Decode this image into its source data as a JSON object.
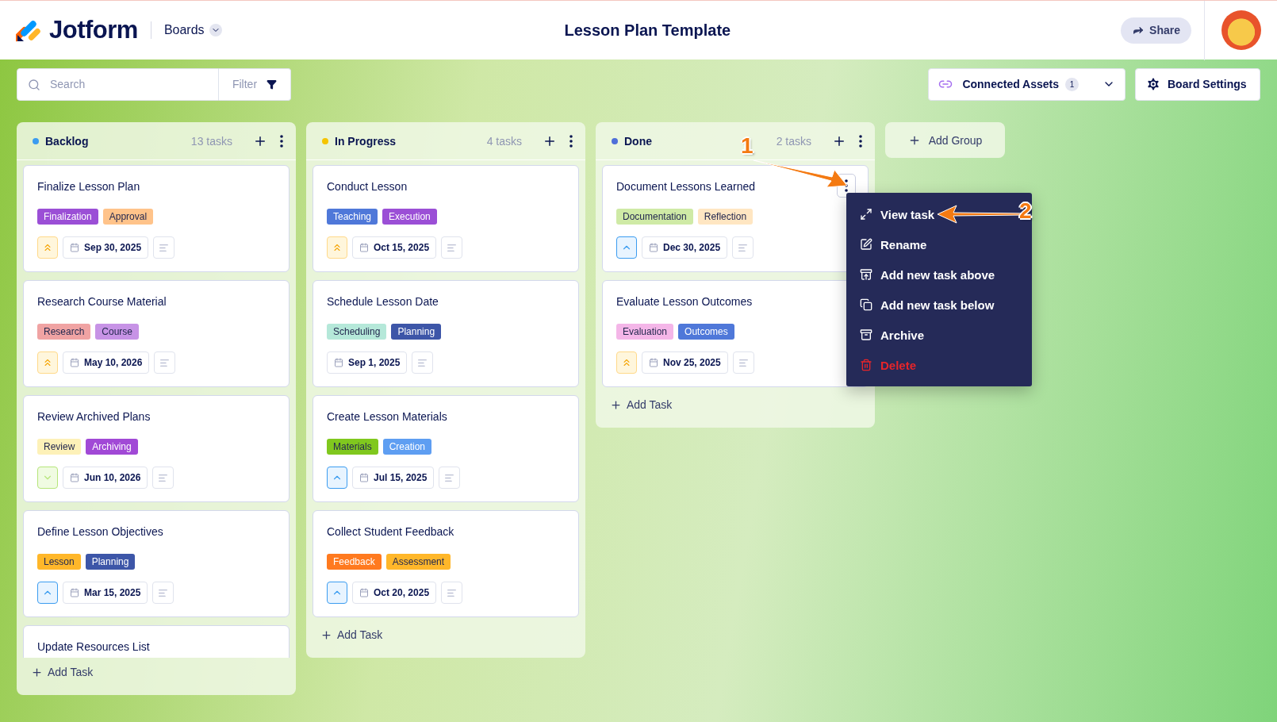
{
  "header": {
    "logo": "Jotform",
    "boards_menu": "Boards",
    "title": "Lesson Plan Template",
    "share_button": "Share"
  },
  "toolbar": {
    "search": {
      "placeholder": "Search"
    },
    "filter_button": "Filter",
    "connected_assets": {
      "label": "Connected Assets",
      "count": "1"
    },
    "board_settings": "Board Settings"
  },
  "groups": [
    {
      "name": "Backlog",
      "color": "#3b9cf0",
      "count": "13 tasks",
      "add_task": "Add Task",
      "cards": [
        {
          "title": "Finalize Lesson Plan",
          "hovered": false,
          "kind": "high",
          "due": "Sep 30, 2025",
          "tags": [
            {
              "label": "Finalization",
              "color": "#9b4fd6"
            },
            {
              "label": "Approval",
              "color": "#ffc38a"
            }
          ]
        },
        {
          "title": "Research Course Material",
          "hovered": false,
          "kind": "high",
          "due": "May 10, 2026",
          "tags": [
            {
              "label": "Research",
              "color": "#f0a3a3"
            },
            {
              "label": "Course",
              "color": "#c793e6"
            }
          ]
        },
        {
          "title": "Review Archived Plans",
          "hovered": false,
          "kind": "low",
          "due": "Jun 10, 2026",
          "tags": [
            {
              "label": "Review",
              "color": "#fdf1b8"
            },
            {
              "label": "Archiving",
              "color": "#a149d6"
            }
          ]
        },
        {
          "title": "Define Lesson Objectives",
          "hovered": false,
          "kind": "medium",
          "due": "Mar 15, 2025",
          "tags": [
            {
              "label": "Lesson",
              "color": "#ffb72a"
            },
            {
              "label": "Planning",
              "color": "#3d56a8"
            }
          ]
        },
        {
          "title": "Update Resources List",
          "hovered": false
        }
      ]
    },
    {
      "name": "In Progress",
      "color": "#f5c400",
      "count": "4 tasks",
      "add_task": "Add Task",
      "cards": [
        {
          "title": "Conduct Lesson",
          "hovered": false,
          "kind": "high",
          "due": "Oct 15, 2025",
          "tags": [
            {
              "label": "Teaching",
              "color": "#4f78d9"
            },
            {
              "label": "Execution",
              "color": "#9b4fd6"
            }
          ]
        },
        {
          "title": "Schedule Lesson Date",
          "hovered": false,
          "kind": "plain",
          "due": "Sep 1, 2025",
          "tags": [
            {
              "label": "Scheduling",
              "color": "#b5e8d9"
            },
            {
              "label": "Planning",
              "color": "#3d56a8"
            }
          ]
        },
        {
          "title": "Create Lesson Materials",
          "hovered": false,
          "kind": "medium",
          "due": "Jul 15, 2025",
          "tags": [
            {
              "label": "Materials",
              "color": "#80c81e"
            },
            {
              "label": "Creation",
              "color": "#5e9ef2"
            }
          ]
        },
        {
          "title": "Collect Student Feedback",
          "hovered": false,
          "kind": "medium",
          "due": "Oct 20, 2025",
          "tags": [
            {
              "label": "Feedback",
              "color": "#ff7a1f"
            },
            {
              "label": "Assessment",
              "color": "#ffb72a"
            }
          ]
        }
      ]
    },
    {
      "name": "Done",
      "color": "#4f6fd9",
      "count": "2 tasks",
      "add_task": "Add Task",
      "cards": [
        {
          "title": "Document Lessons Learned",
          "hovered": true,
          "kind": "medium",
          "due": "Dec 30, 2025",
          "tags": [
            {
              "label": "Documentation",
              "color": "#cfeaa6"
            },
            {
              "label": "Reflection",
              "color": "#ffe6c2"
            }
          ]
        },
        {
          "title": "Evaluate Lesson Outcomes",
          "hovered": false,
          "kind": "high",
          "due": "Nov 25, 2025",
          "tags": [
            {
              "label": "Evaluation",
              "color": "#f4b6e8"
            },
            {
              "label": "Outcomes",
              "color": "#4f78d9"
            }
          ]
        }
      ]
    }
  ],
  "add_group": "Add Group",
  "context_menu": {
    "items": [
      {
        "label": "View task",
        "kind": "normal"
      },
      {
        "label": "Rename",
        "kind": "normal"
      },
      {
        "label": "Add new task above",
        "kind": "normal"
      },
      {
        "label": "Add new task below",
        "kind": "normal"
      },
      {
        "label": "Archive",
        "kind": "normal"
      },
      {
        "label": "Delete",
        "kind": "danger"
      }
    ]
  },
  "annotations": [
    {
      "label": "1"
    },
    {
      "label": "2"
    }
  ]
}
